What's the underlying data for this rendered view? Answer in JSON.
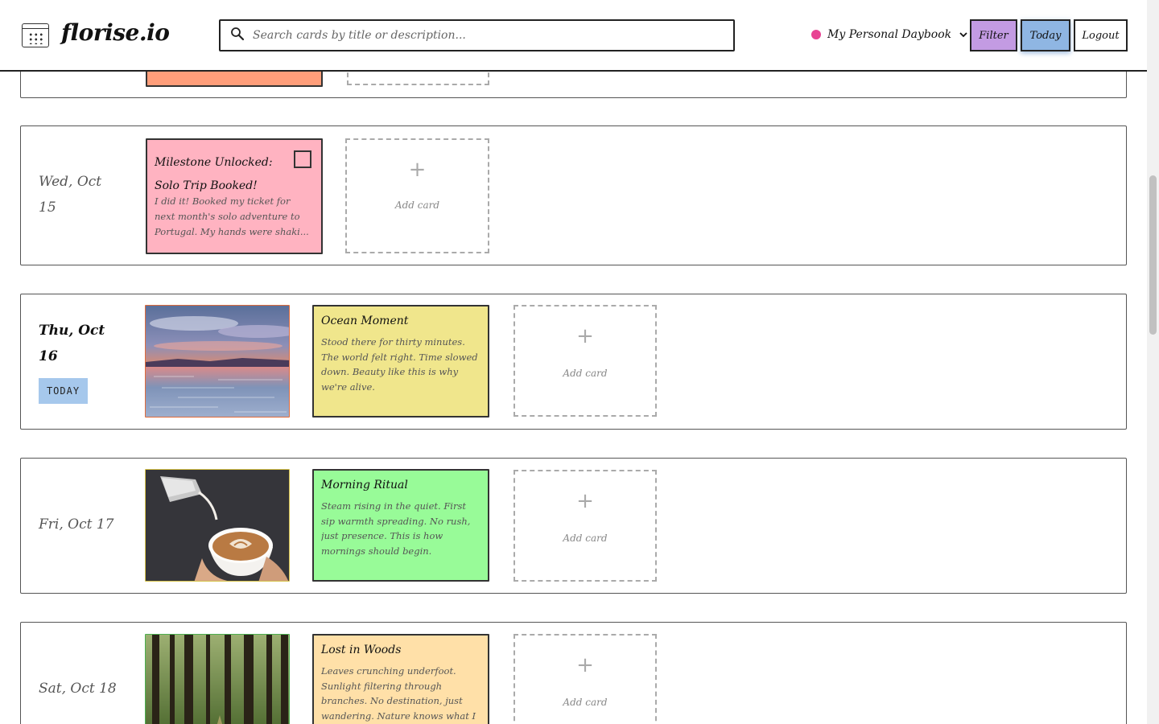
{
  "app": {
    "logo_text": "florise.io",
    "search_placeholder": "Search cards by title or description...",
    "daybook": {
      "name": "My Personal Daybook",
      "dot_color": "#e84393"
    },
    "buttons": {
      "filter": {
        "label": "Filter",
        "color": "#c39be3"
      },
      "today": {
        "label": "Today",
        "color": "#8fb6e3"
      },
      "logout": {
        "label": "Logout"
      }
    }
  },
  "days": [
    {
      "date": "",
      "cards": [
        {
          "type": "note",
          "color": "#ff9e7a"
        }
      ]
    },
    {
      "date_line1": "Wed, Oct",
      "date_line2": "15",
      "cards": [
        {
          "type": "note",
          "title_line1": "Milestone Unlocked:",
          "title_line2": "Solo Trip Booked!",
          "body": "I did it! Booked my ticket for next month's solo adventure to Portugal. My hands were shaki...",
          "color": "#ffb3c1",
          "has_checkbox": true
        }
      ]
    },
    {
      "date_line1": "Thu, Oct",
      "date_line2": "16",
      "is_today": true,
      "today_badge": "TODAY",
      "today_badge_color": "#a6c8ec",
      "cards": [
        {
          "type": "photo",
          "subject": "sunset-over-sea",
          "border_color": "#e06b3a"
        },
        {
          "type": "note",
          "title": "Ocean Moment",
          "body": "Stood there for thirty minutes. The world felt right. Time slowed down. Beauty like this is why we're alive.",
          "color": "#f0e68c"
        }
      ]
    },
    {
      "date": "Fri, Oct 17",
      "cards": [
        {
          "type": "photo",
          "subject": "latte-art-cup",
          "border_color": "#d6c24a"
        },
        {
          "type": "note",
          "title": "Morning Ritual",
          "body": "Steam rising in the quiet. First sip warmth spreading. No rush, just presence. This is how mornings should begin.",
          "color": "#98fb98"
        }
      ]
    },
    {
      "date": "Sat, Oct 18",
      "cards": [
        {
          "type": "photo",
          "subject": "forest-path",
          "border_color": "#4caf50"
        },
        {
          "type": "note",
          "title": "Lost in Woods",
          "body": "Leaves crunching underfoot. Sunlight filtering through branches. No destination, just wandering. Nature knows what I",
          "color": "#ffe0a8"
        }
      ]
    }
  ],
  "add_card": {
    "plus": "+",
    "label": "Add card"
  }
}
